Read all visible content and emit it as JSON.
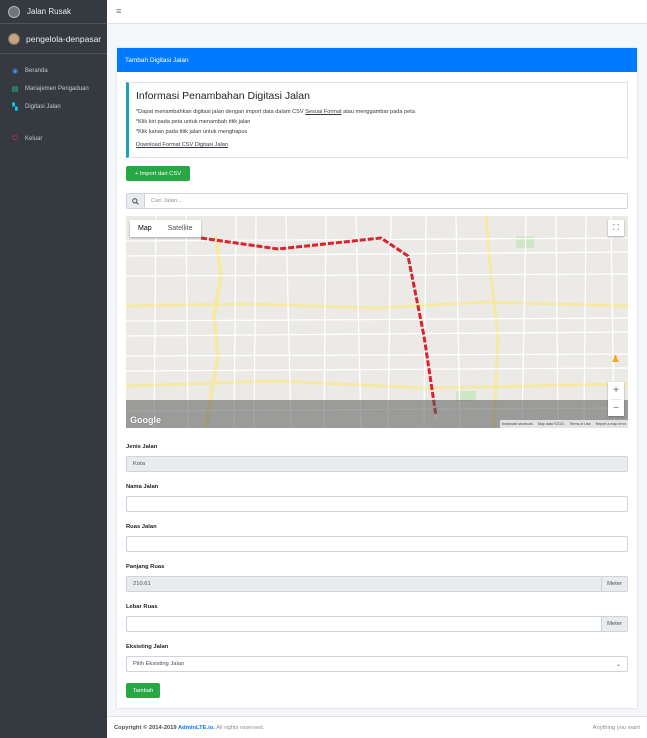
{
  "brand": {
    "title": "Jalan Rusak"
  },
  "user": {
    "name": "pengelola-denpasar"
  },
  "sidebar": {
    "items": [
      {
        "label": "Beranda",
        "icon": "gauge-icon"
      },
      {
        "label": "Manajemen Pengaduan",
        "icon": "document-icon"
      },
      {
        "label": "Digitasi Jalan",
        "icon": "map-icon"
      },
      {
        "label": "Keluar",
        "icon": "power-icon"
      }
    ]
  },
  "card": {
    "title": "Tambah Digitasi Jalan"
  },
  "info": {
    "title": "Informasi Penambahan Digitasi Jalan",
    "line1_a": "*Dapat menambahkan digitasi jalan dengan import data dalam CSV ",
    "line1_link": "Sesuai Format",
    "line1_b": " atau menggambar pada peta",
    "line2": "*Klik kiri pada peta untuk menambah titik jalan",
    "line3": "*Klik kanan pada titik jalan untuk menghapus",
    "download": "Download Format CSV Digitasi Jalan"
  },
  "import_button": "+ Import dari CSV",
  "search": {
    "placeholder": "Cari Jalan..."
  },
  "map": {
    "type_map": "Map",
    "type_satellite": "Satellite",
    "google": "Google",
    "attrib": [
      "Keyboard shortcuts",
      "Map data ©2021",
      "Terms of Use",
      "Report a map error"
    ],
    "route_color": "#d9232d"
  },
  "form": {
    "jenis_label": "Jenis Jalan",
    "jenis_value": "Kota",
    "nama_label": "Nama Jalan",
    "nama_value": "",
    "ruas_label": "Ruas Jalan",
    "ruas_value": "",
    "panjang_label": "Panjang Ruas",
    "panjang_value": "210.61",
    "panjang_unit": "Meter",
    "lebar_label": "Lebar Ruas",
    "lebar_value": "",
    "lebar_unit": "Meter",
    "eksisting_label": "Eksisting Jalan",
    "eksisting_value": "Pilih Eksisting Jalan",
    "submit": "Tambah"
  },
  "footer": {
    "copyright": "Copyright © 2014-2019 ",
    "link": "AdminLTE.io.",
    "rights": " All rights reserved.",
    "right": "Anything you want"
  }
}
